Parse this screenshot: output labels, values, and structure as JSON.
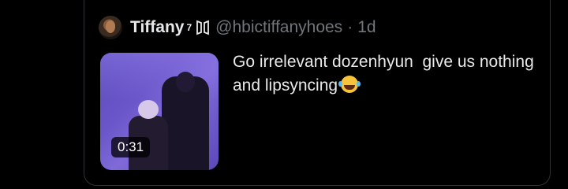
{
  "tweet": {
    "display_name": "Tiffany",
    "superscript": "7",
    "band_icon": "bts-logo-icon",
    "handle": "@hbictiffanyhoes",
    "separator": "·",
    "time": "1d",
    "text": "Go irrelevant dozenhyun  give us nothing and lipsyncing",
    "text_emoji": "face-with-tears-of-joy-icon",
    "media": {
      "type": "video",
      "duration": "0:31"
    }
  }
}
